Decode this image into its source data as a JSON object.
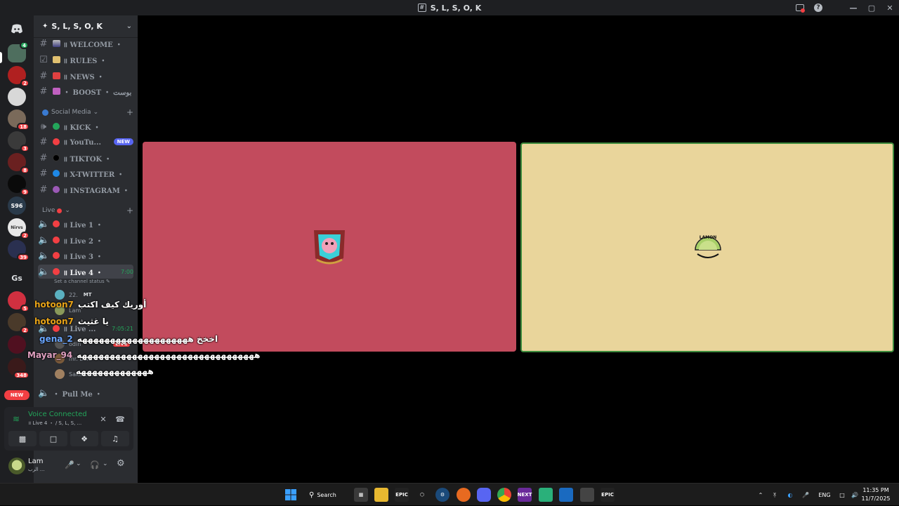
{
  "window": {
    "title": "S, L, S, O, K",
    "title_icon": "hash-server-icon",
    "controls": [
      "minimize",
      "maximize",
      "close"
    ]
  },
  "server": {
    "name": "S, L, S, O, K"
  },
  "rail": {
    "badges": [
      "",
      "2",
      "",
      "18",
      "3",
      "8",
      "9",
      "",
      "2",
      "39",
      "",
      "5",
      "2",
      "",
      "348",
      "NEW"
    ],
    "gs_label": "Gs"
  },
  "channels": {
    "top": [
      {
        "label": "॥ WELCOME ・"
      },
      {
        "label": "॥ RULES ・"
      },
      {
        "label": "॥ NEWS ・"
      },
      {
        "label": "・ BOOST ・ بوست"
      }
    ],
    "social_category": "Social Media",
    "social": [
      {
        "label": "॥ KICK ・",
        "color": "#23a55a"
      },
      {
        "label": "॥ YouTu...",
        "color": "#f23f43",
        "badge": "NEW"
      },
      {
        "label": "॥ TIKTOK ・",
        "color": "#000000"
      },
      {
        "label": "॥ X-TWITTER ・",
        "color": "#1e88e5"
      },
      {
        "label": "॥ INSTAGRAM ・",
        "color": "#9b59b6"
      }
    ],
    "live_category": "Live",
    "live": [
      {
        "label": "॥ Live 1 ・"
      },
      {
        "label": "॥ Live 2 ・"
      },
      {
        "label": "॥ Live 3 ・"
      },
      {
        "label": "॥ Live 4 ・",
        "time": "7:00"
      }
    ],
    "set_status": "Set a channel status",
    "live4_users": [
      {
        "name": "22.",
        "tag": "MT"
      },
      {
        "name": "Lam"
      }
    ],
    "live5": {
      "label": "॥ Live ...",
      "time": "7:05:21"
    },
    "live5_users": [
      {
        "name": "odin",
        "live": "LIVE"
      },
      {
        "name": "mr. balti"
      },
      {
        "name": "Sakaroooo"
      }
    ],
    "pull_me": "・ Pull Me ・"
  },
  "chat_overlay": [
    {
      "nick": "hotoon7",
      "message": "أوريك كيف اكتب",
      "nick_color": "#e8a317"
    },
    {
      "nick": "hotoon7",
      "message": "يا غثيث",
      "nick_color": "#e8a317"
    },
    {
      "nick": "gena_2",
      "message": "اخخخ ههههههههههههههههههههه",
      "nick_color": "#6aa6ff"
    },
    {
      "nick": "Mayar_94",
      "message": "ههههههههههههههههههههههههههههههههه",
      "nick_color": "#e0a0c0"
    },
    {
      "nick": "",
      "message": "هههههههههههههه",
      "nick_color": "#ffffff"
    }
  ],
  "voice": {
    "status": "Voice Connected",
    "location": "॥ Live 4 ・ / S, L, S, ..."
  },
  "user": {
    "name": "Lam",
    "status": "الرب ..."
  },
  "tiles": {
    "red_color": "#c24b5d",
    "yellow_color": "#e9d59b",
    "yellow_avatar_text": "LAMON"
  },
  "taskbar": {
    "search_label": "Search",
    "lang": "ENG",
    "time": "11:35 PM",
    "date": "11/7/2025"
  }
}
